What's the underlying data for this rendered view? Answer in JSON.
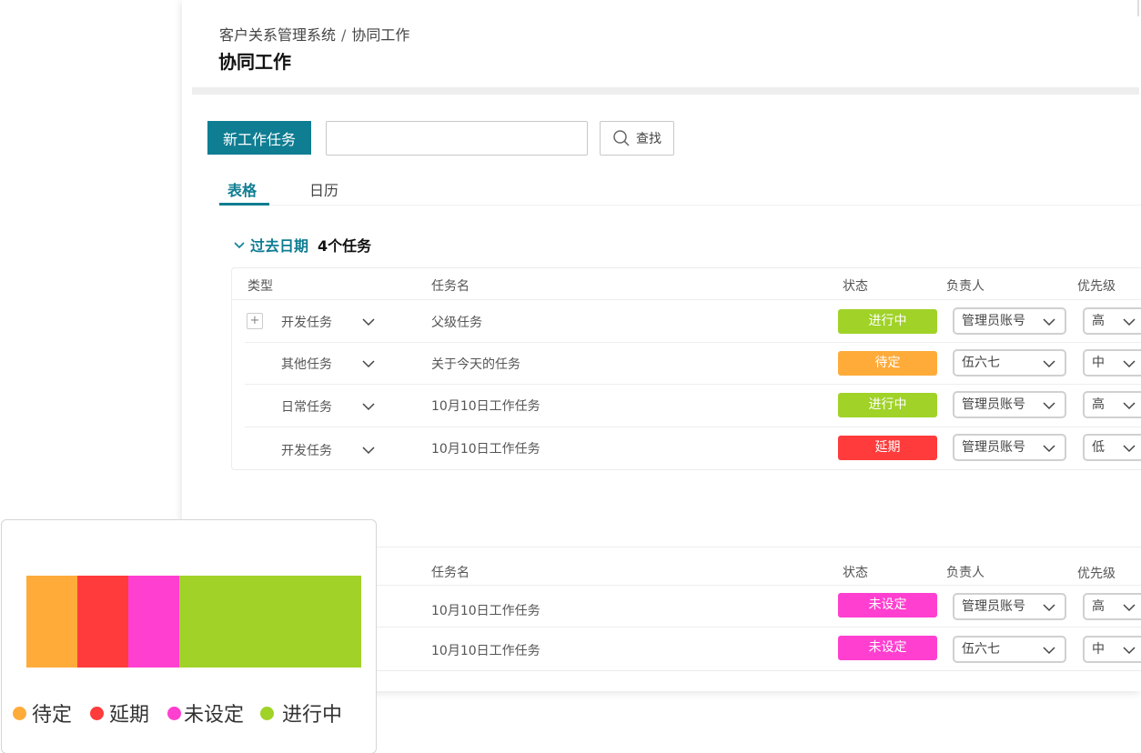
{
  "breadcrumb": {
    "root": "客户关系管理系统",
    "sep": "/",
    "current": "协同工作"
  },
  "page_title": "协同工作",
  "toolbar": {
    "new_task_label": "新工作任务",
    "search_placeholder": "",
    "find_label": "查找"
  },
  "tabs": [
    {
      "label": "表格",
      "active": true
    },
    {
      "label": "日历",
      "active": false
    }
  ],
  "group": {
    "title": "过去日期",
    "count": "4个任务"
  },
  "columns": {
    "type": "类型",
    "name": "任务名",
    "status": "状态",
    "owner": "负责人",
    "priority": "优先级"
  },
  "colors": {
    "accent": "#0f7d92",
    "pending": "#ffab3a",
    "delayed": "#ff3b3b",
    "unset": "#ff3fd0",
    "in_progress": "#a0d228"
  },
  "rows_past": [
    {
      "type": "开发任务",
      "name": "父级任务",
      "status": "进行中",
      "status_color": "#a0d228",
      "owner": "管理员账号",
      "priority": "高",
      "expandable": true
    },
    {
      "type": "其他任务",
      "name": "关于今天的任务",
      "status": "待定",
      "status_color": "#ffab3a",
      "owner": "伍六七",
      "priority": "中",
      "expandable": false
    },
    {
      "type": "日常任务",
      "name": "10月10日工作任务",
      "status": "进行中",
      "status_color": "#a0d228",
      "owner": "管理员账号",
      "priority": "高",
      "expandable": false
    },
    {
      "type": "开发任务",
      "name": "10月10日工作任务",
      "status": "延期",
      "status_color": "#ff3b3b",
      "owner": "管理员账号",
      "priority": "低",
      "expandable": false
    }
  ],
  "rows_second": [
    {
      "name": "10月10日工作任务",
      "status": "未设定",
      "status_color": "#ff3fd0",
      "owner": "管理员账号",
      "priority": "高"
    },
    {
      "name": "10月10日工作任务",
      "status": "未设定",
      "status_color": "#ff3fd0",
      "owner": "伍六七",
      "priority": "中"
    }
  ],
  "legend": {
    "segments": [
      {
        "label": "待定",
        "share": 0.152,
        "color": "#ffab3a"
      },
      {
        "label": "延期",
        "share": 0.152,
        "color": "#ff3b3b"
      },
      {
        "label": "未设定",
        "share": 0.152,
        "color": "#ff3fd0"
      },
      {
        "label": "进行中",
        "share": 0.544,
        "color": "#a0d228"
      }
    ]
  }
}
